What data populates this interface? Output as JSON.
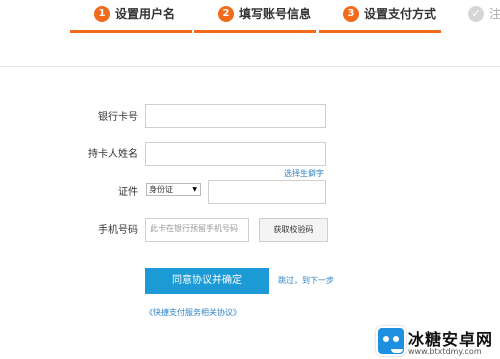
{
  "steps": [
    {
      "num": "1",
      "label": "设置用户名"
    },
    {
      "num": "2",
      "label": "填写账号信息"
    },
    {
      "num": "3",
      "label": "设置支付方式"
    },
    {
      "num": "✓",
      "label": "注"
    }
  ],
  "form": {
    "card_label": "银行卡号",
    "name_label": "持卡人姓名",
    "rare_char_link": "选择生僻字",
    "id_label": "证件",
    "id_type": "身份证",
    "phone_label": "手机号码",
    "phone_placeholder": "此卡在银行预留手机号码",
    "get_code_button": "获取校验码",
    "submit_button": "同意协议并确定",
    "skip_link": "跳过，到下一步",
    "agreement_link": "《快捷支付服务相关协议》"
  },
  "watermark": {
    "name": "冰糖安卓网",
    "url": "www.btxtdmy.com"
  },
  "colors": {
    "accent": "#f26b1d",
    "primary_button": "#1b9ad6",
    "link": "#2f83c9"
  }
}
